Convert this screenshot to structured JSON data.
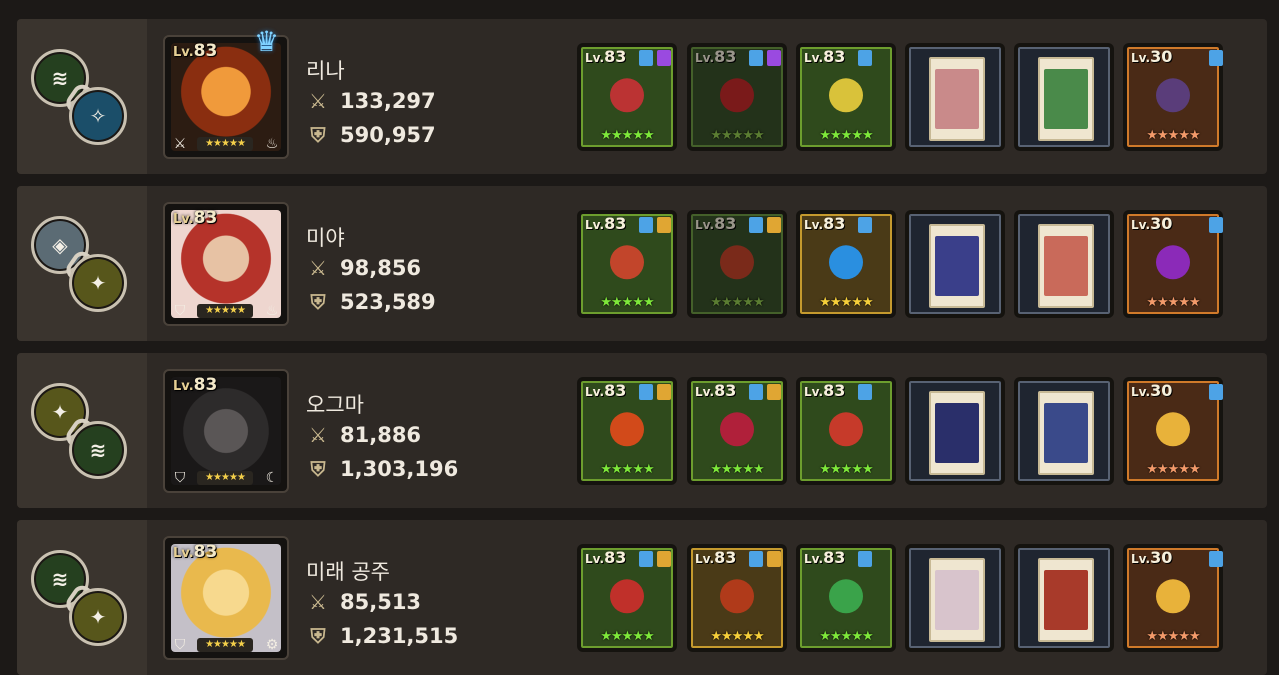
{
  "rows": [
    {
      "hero_name": "리나",
      "atk": "133,297",
      "def": "590,957",
      "level": "83",
      "lv_prefix": "Lv.",
      "left_icons": [
        "claw-mark-icon",
        "wing-mark-icon"
      ],
      "hero_icons": [
        "sword-class-icon",
        "fire-element-icon"
      ],
      "crowned": true,
      "equipment": [
        {
          "level": "83",
          "style": "green",
          "stars": "★★★★★"
        },
        {
          "level": "83",
          "style": "green dim",
          "stars": "★★★★★"
        },
        {
          "level": "83",
          "style": "green",
          "stars": "★★★★★"
        },
        {
          "level": "",
          "style": "card",
          "stars": ""
        },
        {
          "level": "",
          "style": "card",
          "stars": ""
        },
        {
          "level": "30",
          "style": "orange",
          "stars": "★★★★★"
        }
      ]
    },
    {
      "hero_name": "미야",
      "atk": "98,856",
      "def": "523,589",
      "level": "83",
      "lv_prefix": "Lv.",
      "left_icons": [
        "diamond-mark-icon",
        "star-mark-icon"
      ],
      "hero_icons": [
        "shield-class-icon",
        "fire-element-icon"
      ],
      "crowned": false,
      "equipment": [
        {
          "level": "83",
          "style": "green",
          "stars": "★★★★★"
        },
        {
          "level": "83",
          "style": "green dim",
          "stars": "★★★★★"
        },
        {
          "level": "83",
          "style": "gold",
          "stars": "★★★★★"
        },
        {
          "level": "",
          "style": "card",
          "stars": ""
        },
        {
          "level": "",
          "style": "card",
          "stars": ""
        },
        {
          "level": "30",
          "style": "orange",
          "stars": "★★★★★"
        }
      ]
    },
    {
      "hero_name": "오그마",
      "atk": "81,886",
      "def": "1,303,196",
      "level": "83",
      "lv_prefix": "Lv.",
      "left_icons": [
        "star-mark-icon",
        "claw-mark-icon"
      ],
      "hero_icons": [
        "shield-class-icon",
        "moon-element-icon"
      ],
      "crowned": false,
      "equipment": [
        {
          "level": "83",
          "style": "green",
          "stars": "★★★★★"
        },
        {
          "level": "83",
          "style": "green",
          "stars": "★★★★★"
        },
        {
          "level": "83",
          "style": "green",
          "stars": "★★★★★"
        },
        {
          "level": "",
          "style": "card",
          "stars": ""
        },
        {
          "level": "",
          "style": "card",
          "stars": ""
        },
        {
          "level": "30",
          "style": "orange",
          "stars": "★★★★★"
        }
      ]
    },
    {
      "hero_name": "미래 공주",
      "atk": "85,513",
      "def": "1,231,515",
      "level": "83",
      "lv_prefix": "Lv.",
      "left_icons": [
        "claw-mark-icon",
        "star-mark-icon"
      ],
      "hero_icons": [
        "shield-class-icon",
        "gear-element-icon"
      ],
      "crowned": false,
      "equipment": [
        {
          "level": "83",
          "style": "green",
          "stars": "★★★★★"
        },
        {
          "level": "83",
          "style": "gold",
          "stars": "★★★★★"
        },
        {
          "level": "83",
          "style": "green",
          "stars": "★★★★★"
        },
        {
          "level": "",
          "style": "card",
          "stars": ""
        },
        {
          "level": "",
          "style": "card",
          "stars": ""
        },
        {
          "level": "30",
          "style": "orange",
          "stars": "★★★★★"
        }
      ]
    }
  ],
  "colors": {
    "panel": "#2e2925",
    "panel_left": "#3a342e",
    "green_frame": "#6d9e2e",
    "gold_frame": "#c59a2e",
    "orange_frame": "#d07a2a",
    "card_frame": "#586273"
  }
}
